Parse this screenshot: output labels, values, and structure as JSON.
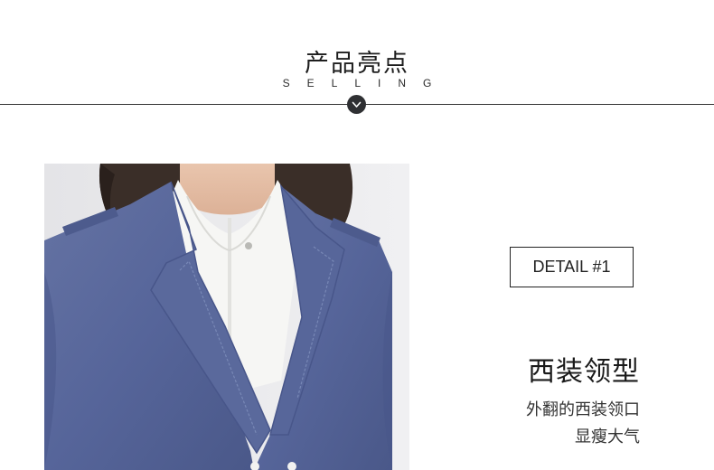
{
  "header": {
    "title": "产品亮点",
    "subtitle": "SELLING"
  },
  "detail": {
    "label": "DETAIL #1"
  },
  "feature": {
    "title": "西装领型",
    "lines": [
      "外翻的西装领口",
      "显瘦大气"
    ]
  },
  "colors": {
    "jacket": "#5b6a9a",
    "shirt": "#f7f7f5",
    "badge": "#2f3033",
    "background": "#ffffff"
  },
  "icons": {
    "divider_badge": "chevron-down-icon"
  }
}
